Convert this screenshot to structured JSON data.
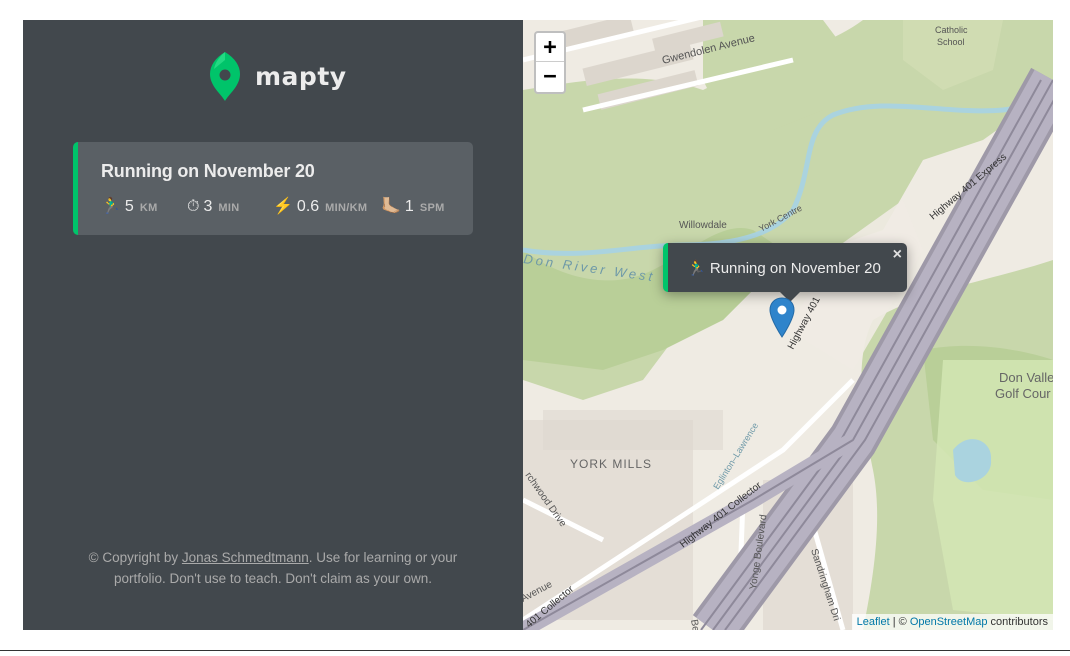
{
  "app": {
    "name": "mapty",
    "accent_color": "#00c46a",
    "sidebar_color": "#42484d"
  },
  "workouts": [
    {
      "title": "Running on November 20",
      "type": "running",
      "details": [
        {
          "icon": "runner-icon",
          "glyph": "🏃‍♂️",
          "value": "5",
          "unit": "KM"
        },
        {
          "icon": "stopwatch-icon",
          "glyph": "⏱",
          "value": "3",
          "unit": "MIN"
        },
        {
          "icon": "lightning-icon",
          "glyph": "⚡️",
          "value": "0.6",
          "unit": "MIN/KM"
        },
        {
          "icon": "footprint-icon",
          "glyph": "🦶🏼",
          "value": "1",
          "unit": "SPM"
        }
      ]
    }
  ],
  "footer": {
    "prefix": "© Copyright by ",
    "author": "Jonas Schmedtmann",
    "suffix": ". Use for learning or your portfolio. Don't use to teach. Don't claim as your own."
  },
  "map": {
    "zoom_in": "+",
    "zoom_out": "−",
    "popup": {
      "glyph": "🏃‍♂️",
      "text": "Running on November 20",
      "close": "×"
    },
    "labels": {
      "gwendolen": "Gwendolen Avenue",
      "catholic": "Catholic",
      "school": "School",
      "willowdale": "Willowdale",
      "york_centre": "York Centre",
      "don_river": "Don River West",
      "highway_401": "Highway 401",
      "highway_401_express": "Highway 401 Express",
      "highway_401_collector": "Highway 401 Collector",
      "york_mills": "YORK MILLS",
      "don_valley": "Don Valle",
      "golf_course": "Golf Cour",
      "yonge": "Yonge Boulevard",
      "sandringham": "Sandringham Dri",
      "eglinton": "Eglinton–Lawrence",
      "archwood": "rchwood Drive",
      "avenue": "Avenue",
      "collector": "401 Collector",
      "bel": "Bel"
    },
    "attribution": {
      "leaflet": "Leaflet",
      "separator": " | © ",
      "osm": "OpenStreetMap",
      "contributors": " contributors"
    }
  }
}
